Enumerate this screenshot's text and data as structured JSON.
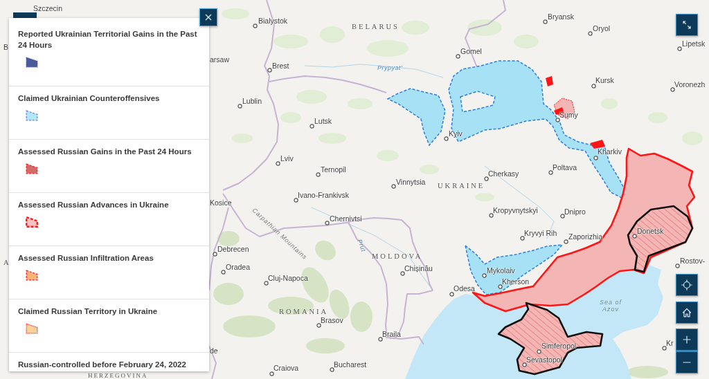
{
  "legend": {
    "items": [
      {
        "title": "Reported Ukrainian Territorial Gains in the Past 24 Hours",
        "kind": "dotted",
        "color": "#4a5b99"
      },
      {
        "title": "Claimed Ukrainian Counteroffensives",
        "kind": "dashed",
        "color": "#b2e6fb"
      },
      {
        "title": "Assessed Russian Gains in the Past 24 Hours",
        "kind": "dashed",
        "color": "#cf6b6b"
      },
      {
        "title": "Assessed Russian Advances in Ukraine",
        "kind": "heavy",
        "color": "#f6c3c3"
      },
      {
        "title": "Assessed Russian Infiltration Areas",
        "kind": "dashed",
        "color": "#fbb27a"
      },
      {
        "title": "Claimed Russian Territory in Ukraine",
        "kind": "dotted",
        "color": "#fdd09a"
      },
      {
        "title": "Russian-controlled before February 24, 2022",
        "kind": "text"
      }
    ]
  },
  "map": {
    "countries": [
      "BELARUS",
      "UKRAINE",
      "MOLDOVA",
      "A",
      "ROMANIA",
      "HERZEGOVINA"
    ],
    "places": [
      "Szczecin",
      "Bialystok",
      "Bryansk",
      "Oryol",
      "B",
      "Lipetsk",
      "Gomel",
      "arsaw",
      "Brest",
      "Kursk",
      "Voronezh",
      "Lublin",
      "Sumy",
      "Lutsk",
      "Kyiv",
      "Kharkiv",
      "Lviv",
      "Poltava",
      "Ternopil",
      "Cherkasy",
      "Vinnytsia",
      "Ivano-Frankivsk",
      "Kosice",
      "Kropyvnytskyi",
      "Dnipro",
      "Chernivtsi",
      "Donetsk",
      "Kryvyi Rih",
      "Zaporizhia",
      "Debrecen",
      "Rostov-",
      "Oradea",
      "Chișinău",
      "Mykolaiv",
      "Cluj-Napoca",
      "Kherson",
      "Odesa",
      "Brasov",
      "Braila",
      "Kr",
      "Simferopol",
      "de",
      "Sevastopol",
      "Bucharest",
      "Craiova"
    ],
    "water": [
      "Prypyat'",
      "Prut",
      "Sea of Azov"
    ],
    "mountains": [
      "Carpathian Mountains"
    ]
  }
}
